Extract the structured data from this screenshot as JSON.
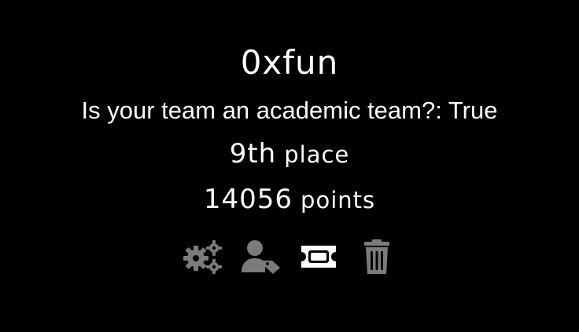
{
  "team": {
    "name": "0xfun",
    "academic_text": "Is your team an academic team?: True"
  },
  "standing": {
    "place_value": "9th",
    "place_label": "place",
    "points_value": "14056",
    "points_label": "points"
  },
  "actions": [
    {
      "icon": "gears-icon",
      "color": "#7b7b7b"
    },
    {
      "icon": "user-tag-icon",
      "color": "#7b7b7b"
    },
    {
      "icon": "ticket-icon",
      "color": "#ffffff"
    },
    {
      "icon": "trash-icon",
      "color": "#7b7b7b"
    }
  ],
  "colors": {
    "background": "#000000",
    "text": "#ffffff",
    "icon_muted": "#7b7b7b",
    "icon_active": "#ffffff"
  }
}
